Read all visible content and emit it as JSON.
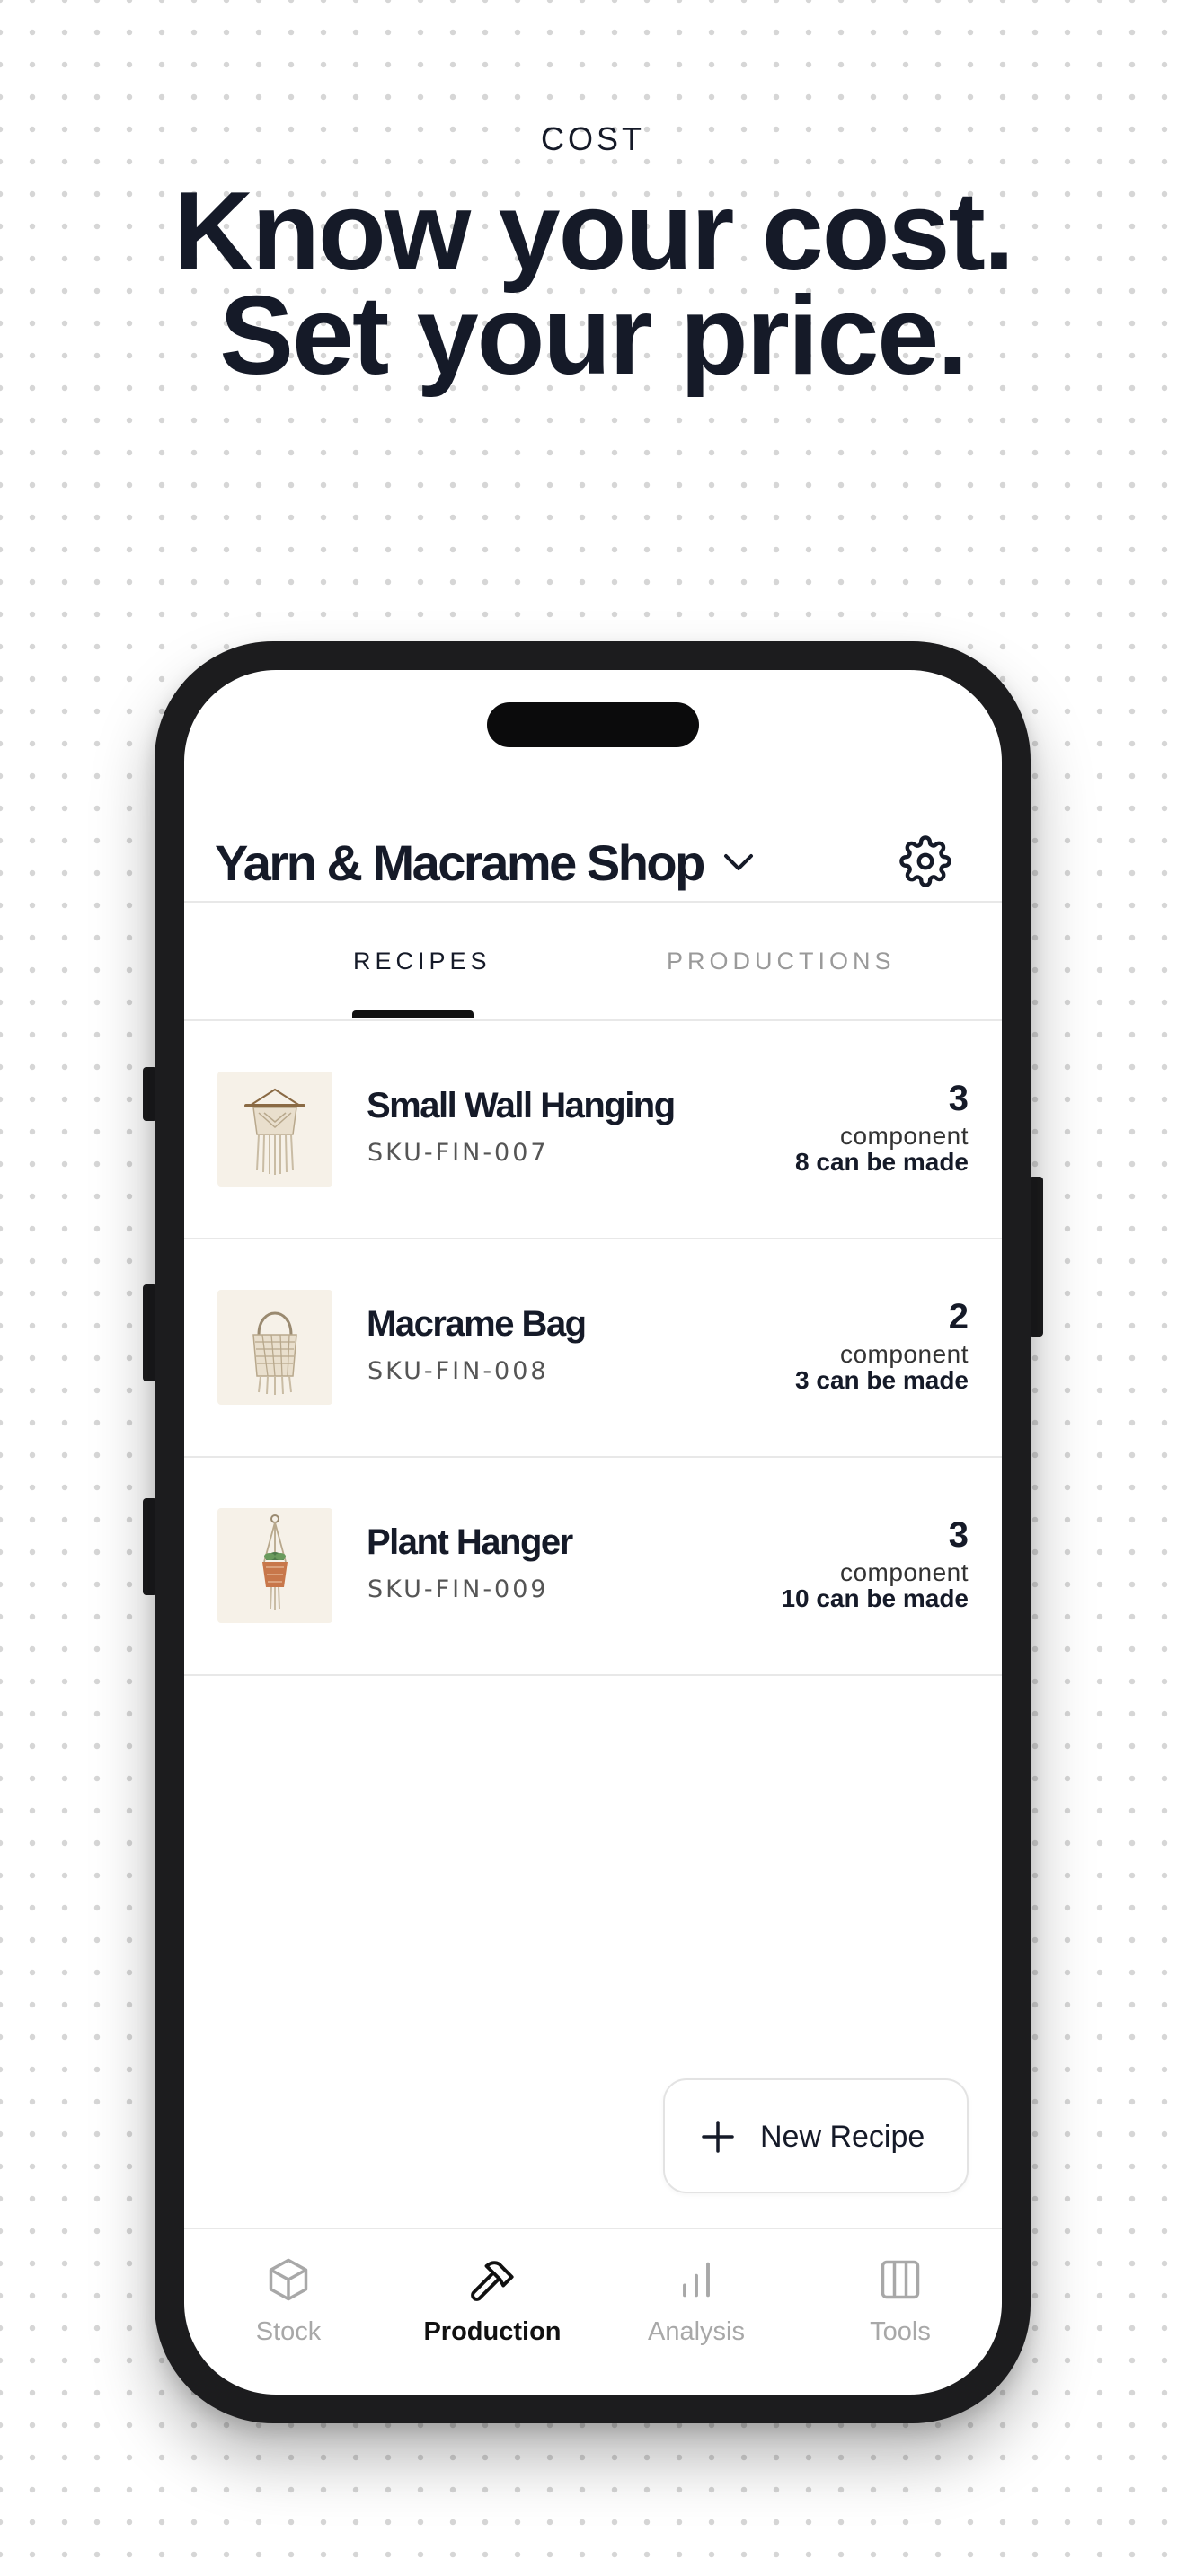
{
  "hero": {
    "eyebrow": "COST",
    "headline_line1": "Know your cost.",
    "headline_line2": "Set your price."
  },
  "header": {
    "shop_name": "Yarn & Macrame Shop",
    "dropdown_icon": "chevron-down-icon",
    "settings_icon": "gear-icon"
  },
  "tabs": [
    {
      "label": "RECIPES",
      "active": true
    },
    {
      "label": "PRODUCTIONS",
      "active": false
    }
  ],
  "recipes": [
    {
      "name": "Small Wall Hanging",
      "sku": "SKU-FIN-007",
      "component_count": "3",
      "component_label": "component",
      "can_be_made": "8 can be made",
      "thumbnail": "wall-hanging-image"
    },
    {
      "name": "Macrame Bag",
      "sku": "SKU-FIN-008",
      "component_count": "2",
      "component_label": "component",
      "can_be_made": "3 can be made",
      "thumbnail": "macrame-bag-image"
    },
    {
      "name": "Plant Hanger",
      "sku": "SKU-FIN-009",
      "component_count": "3",
      "component_label": "component",
      "can_be_made": "10 can be made",
      "thumbnail": "plant-hanger-image"
    }
  ],
  "fab": {
    "label": "New Recipe",
    "icon": "plus-icon"
  },
  "bottom_nav": [
    {
      "label": "Stock",
      "icon": "box-icon",
      "active": false
    },
    {
      "label": "Production",
      "icon": "hammer-icon",
      "active": true
    },
    {
      "label": "Analysis",
      "icon": "bar-chart-icon",
      "active": false
    },
    {
      "label": "Tools",
      "icon": "columns-icon",
      "active": false
    }
  ],
  "colors": {
    "text_primary": "#151a28",
    "text_muted": "#9a9a9a",
    "phone_frame": "#1c1c1e",
    "thumb_bg": "#f6f1e8"
  }
}
